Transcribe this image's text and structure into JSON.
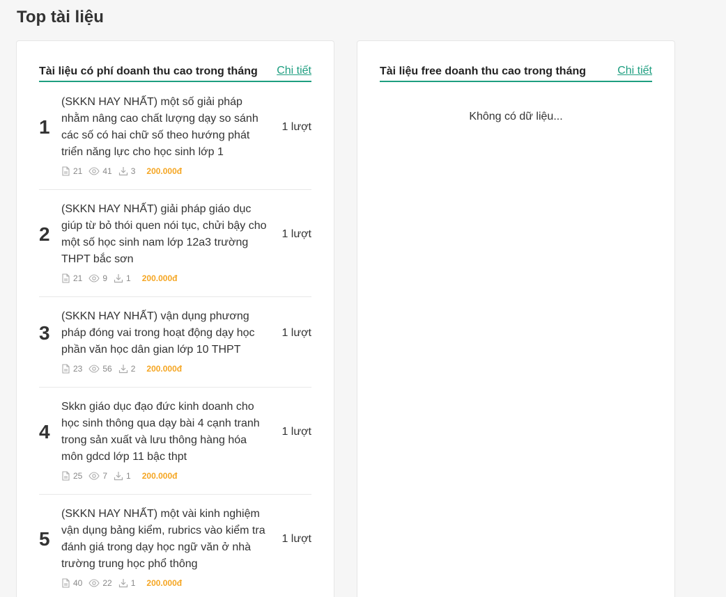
{
  "page": {
    "title": "Top tài liệu"
  },
  "paid_panel": {
    "title": "Tài liệu có phí doanh thu cao trong tháng",
    "detail_label": "Chi tiết",
    "items": [
      {
        "rank": "1",
        "title": "(SKKN HAY NHẤT) một số giải pháp nhằm nâng cao chất lượng dạy so sánh các số có hai chữ số theo hướng phát triển năng lực cho học sinh lớp 1",
        "count": "1 lượt",
        "pages": "21",
        "views": "41",
        "downloads": "3",
        "price": "200.000đ"
      },
      {
        "rank": "2",
        "title": "(SKKN HAY NHẤT) giải pháp giáo dục giúp từ bỏ thói quen nói tục, chửi bậy cho một số học sinh nam lớp 12a3 trường THPT bắc sơn",
        "count": "1 lượt",
        "pages": "21",
        "views": "9",
        "downloads": "1",
        "price": "200.000đ"
      },
      {
        "rank": "3",
        "title": "(SKKN HAY NHẤT) vận dụng phương pháp đóng vai trong hoạt động dạy học phần văn học dân gian lớp 10 THPT",
        "count": "1 lượt",
        "pages": "23",
        "views": "56",
        "downloads": "2",
        "price": "200.000đ"
      },
      {
        "rank": "4",
        "title": "Skkn giáo dục đạo đức kinh doanh cho học sinh thông qua dạy bài 4 cạnh tranh trong sản xuất và lưu thông hàng hóa môn gdcd lớp 11 bậc thpt",
        "count": "1 lượt",
        "pages": "25",
        "views": "7",
        "downloads": "1",
        "price": "200.000đ"
      },
      {
        "rank": "5",
        "title": "(SKKN HAY NHẤT) một vài kinh nghiệm vận dụng bảng kiểm, rubrics vào kiểm tra đánh giá trong dạy học ngữ văn ở nhà trường trung học phổ thông",
        "count": "1 lượt",
        "pages": "40",
        "views": "22",
        "downloads": "1",
        "price": "200.000đ"
      }
    ]
  },
  "free_panel": {
    "title": "Tài liệu free doanh thu cao trong tháng",
    "detail_label": "Chi tiết",
    "empty_text": "Không có dữ liệu..."
  },
  "colors": {
    "accent": "#1e9e80",
    "price": "#f5a623",
    "background": "#f6f6f6"
  },
  "icons": {
    "pages": "file-icon",
    "views": "eye-icon",
    "downloads": "download-icon"
  }
}
